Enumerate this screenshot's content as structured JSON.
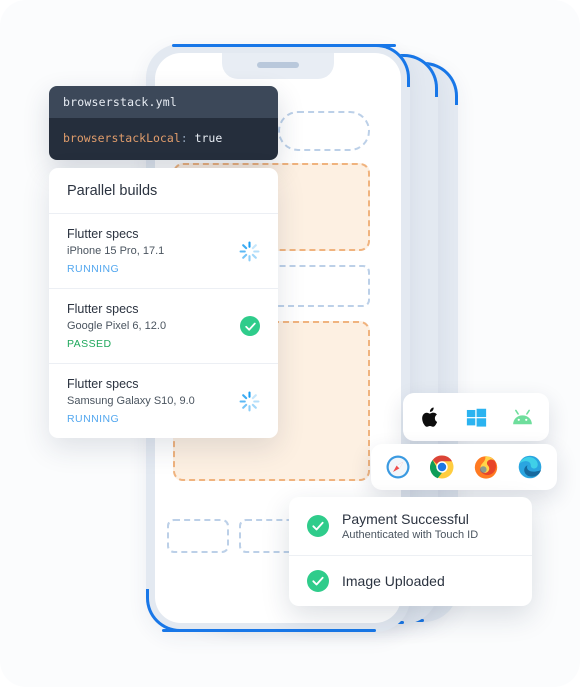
{
  "code_snippet": {
    "filename": "browserstack.yml",
    "key": "browserstackLocal",
    "separator": ":",
    "value": "true"
  },
  "builds": {
    "title": "Parallel builds",
    "rows": [
      {
        "name": "Flutter specs",
        "device": "iPhone 15 Pro, 17.1",
        "status": "RUNNING",
        "status_icon": "spinner-icon",
        "status_color": "#53a7ef"
      },
      {
        "name": "Flutter specs",
        "device": "Google Pixel 6, 12.0",
        "status": "PASSED",
        "status_icon": "check-circle-icon",
        "status_color": "#1fa85c"
      },
      {
        "name": "Flutter specs",
        "device": "Samsung Galaxy S10, 9.0",
        "status": "RUNNING",
        "status_icon": "spinner-icon",
        "status_color": "#53a7ef"
      }
    ]
  },
  "os_strip": {
    "icons": [
      "apple-icon",
      "windows-icon",
      "android-icon"
    ]
  },
  "browser_strip": {
    "icons": [
      "safari-icon",
      "chrome-icon",
      "firefox-icon",
      "edge-icon"
    ]
  },
  "notifications": [
    {
      "icon": "check-circle-icon",
      "title": "Payment Successful",
      "subtitle": "Authenticated with Touch ID"
    },
    {
      "icon": "check-circle-icon",
      "title": "Image Uploaded",
      "subtitle": ""
    }
  ],
  "colors": {
    "accent_blue": "#1877e8",
    "success_green": "#2fcc8b",
    "running_blue": "#53a7ef",
    "passed_green": "#1fa85c",
    "wireframe_blue": "#bcd0e8",
    "wireframe_orange": "#f0b37e",
    "wireframe_orange_fill": "#fdf0e2",
    "code_header_bg": "#3c4859",
    "code_body_bg": "#252e3c",
    "canvas_bg": "#fbfcfd"
  }
}
